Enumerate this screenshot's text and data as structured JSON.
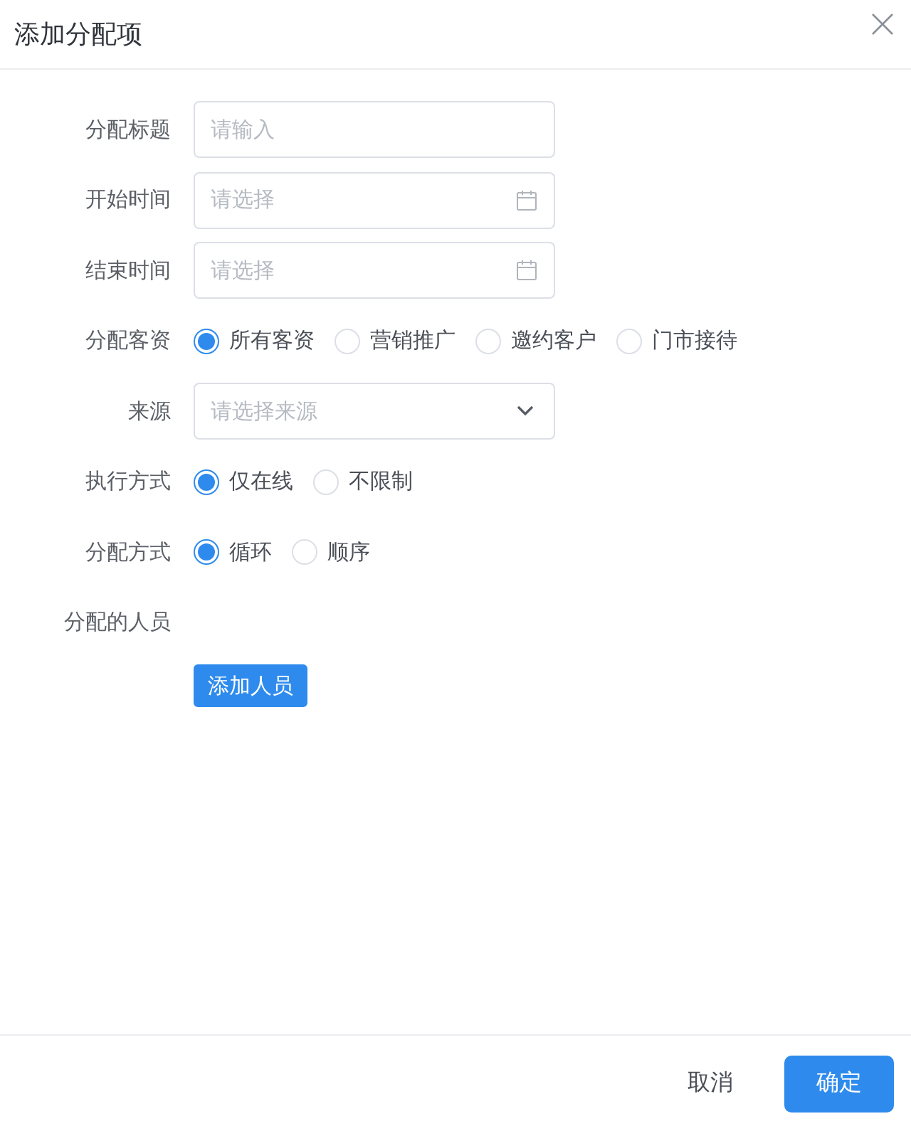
{
  "dialog": {
    "title": "添加分配项"
  },
  "fields": [
    {
      "kind": "input",
      "label": "分配标题",
      "placeholder": "请输入"
    },
    {
      "kind": "date",
      "label": "开始时间",
      "placeholder": "请选择"
    },
    {
      "kind": "date",
      "label": "结束时间",
      "placeholder": "请选择"
    },
    {
      "kind": "radio",
      "label": "分配客资",
      "options": [
        {
          "label": "所有客资",
          "selected": true
        },
        {
          "label": "营销推广",
          "selected": false
        },
        {
          "label": "邀约客户",
          "selected": false
        },
        {
          "label": "门市接待",
          "selected": false
        }
      ]
    },
    {
      "kind": "select",
      "label": "来源",
      "placeholder": "请选择来源"
    },
    {
      "kind": "radio",
      "label": "执行方式",
      "options": [
        {
          "label": "仅在线",
          "selected": true
        },
        {
          "label": "不限制",
          "selected": false
        }
      ]
    },
    {
      "kind": "radio",
      "label": "分配方式",
      "options": [
        {
          "label": "循环",
          "selected": true
        },
        {
          "label": "顺序",
          "selected": false
        }
      ]
    },
    {
      "kind": "people",
      "label": "分配的人员",
      "button": "添加人员"
    }
  ],
  "footer": {
    "cancel": "取消",
    "confirm": "确定"
  }
}
